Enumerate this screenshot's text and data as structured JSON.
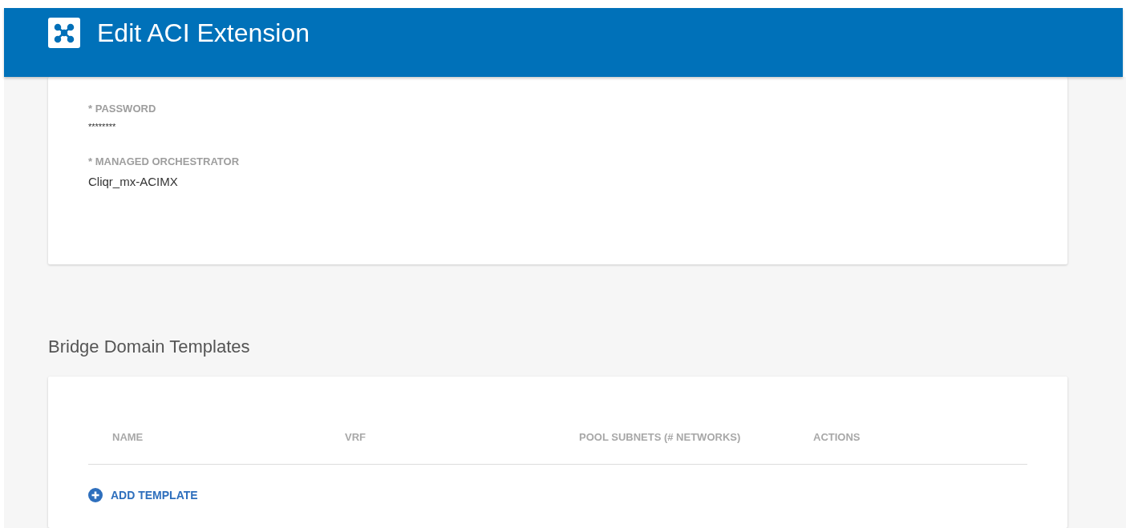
{
  "window": {
    "title": "Edit ACI Extension"
  },
  "fields": [
    {
      "label": "* PASSWORD",
      "value": "********",
      "kind": "password"
    },
    {
      "label": "* MANAGED ORCHESTRATOR",
      "value": "Cliqr_mx-ACIMX",
      "kind": "text"
    }
  ],
  "section": {
    "title": "Bridge Domain Templates"
  },
  "table": {
    "columns": [
      "NAME",
      "VRF",
      "POOL SUBNETS (# NETWORKS)",
      "ACTIONS"
    ]
  },
  "add_button": {
    "label": "ADD TEMPLATE"
  }
}
